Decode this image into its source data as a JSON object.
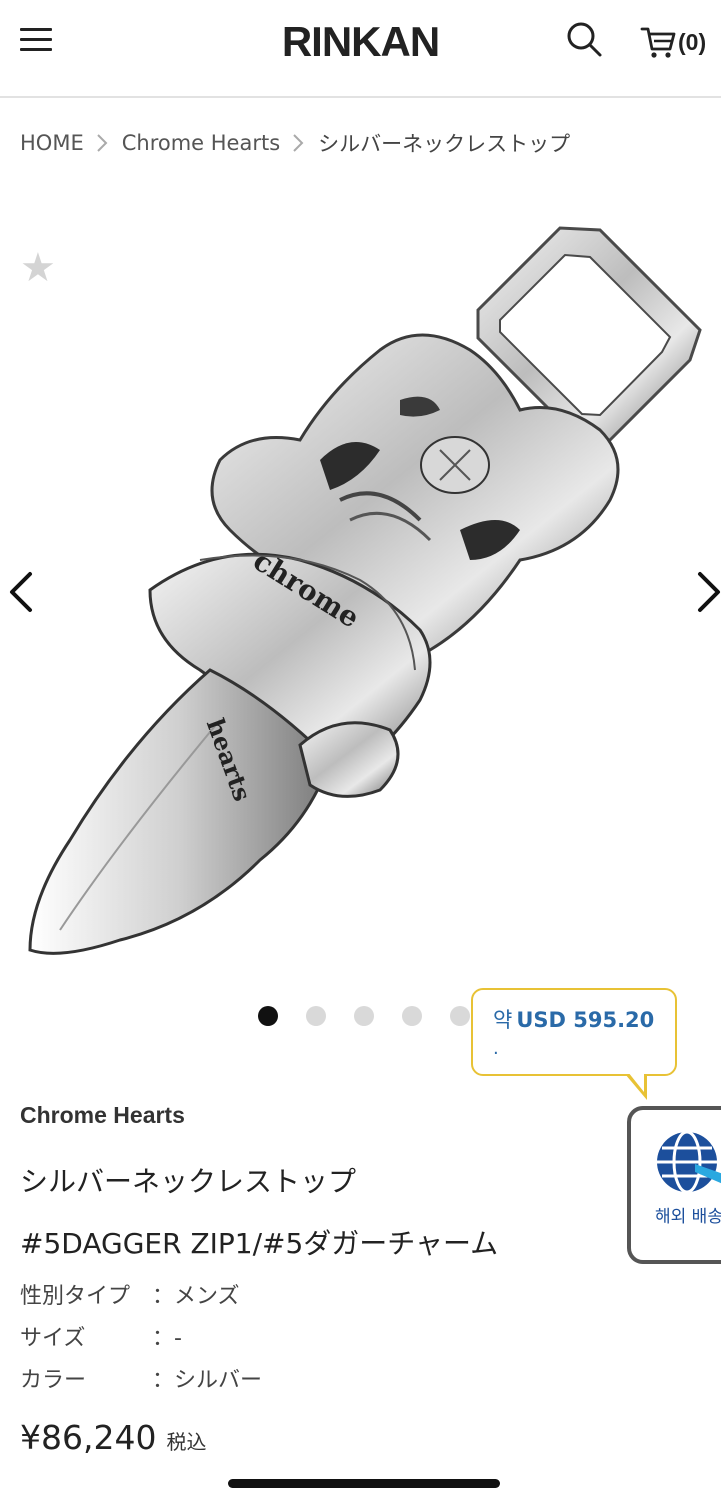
{
  "header": {
    "logo": "RINKAN",
    "cart_count": "(0)"
  },
  "breadcrumb": [
    {
      "label": "HOME"
    },
    {
      "label": "Chrome Hearts"
    },
    {
      "label": "シルバーネックレストップ"
    }
  ],
  "gallery": {
    "product_image_alt": "Chrome Hearts #5 Dagger Zip Charm",
    "slide_count": 5,
    "active_slide": 1
  },
  "currency_popup": {
    "prefix": "약",
    "value": "USD 595.20",
    "dot": "."
  },
  "shipping_widget": {
    "label": "해외 배송"
  },
  "product": {
    "brand": "Chrome Hearts",
    "name_line1": "シルバーネックレストップ",
    "name_line2": "#5DAGGER ZIP1/#5ダガーチャーム",
    "specs": [
      {
        "key": "性別タイプ",
        "value": "：メンズ"
      },
      {
        "key": "サイズ",
        "value": "：-"
      },
      {
        "key": "カラー",
        "value": "：シルバー"
      }
    ],
    "price": "¥86,240",
    "tax_label": "税込"
  },
  "colors": {
    "accent_blue": "#2a6aa8",
    "bubble_border": "#e8c235",
    "active_dot": "#111111"
  }
}
